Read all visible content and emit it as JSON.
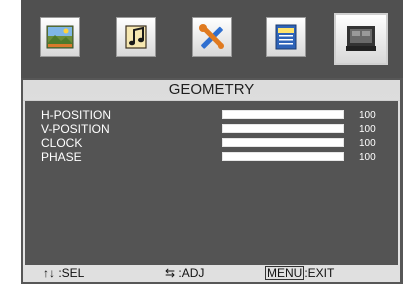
{
  "menu": {
    "tabs": [
      {
        "icon": "picture-icon",
        "selected": false
      },
      {
        "icon": "audio-icon",
        "selected": false
      },
      {
        "icon": "setup-tools-icon",
        "selected": false
      },
      {
        "icon": "info-icon",
        "selected": false
      },
      {
        "icon": "geometry-monitor-icon",
        "selected": true
      }
    ],
    "title": "GEOMETRY",
    "items": [
      {
        "label": "H-POSITION",
        "value": "100",
        "level": 1.0
      },
      {
        "label": "V-POSITION",
        "value": "100",
        "level": 1.0
      },
      {
        "label": "CLOCK",
        "value": "100",
        "level": 1.0
      },
      {
        "label": "PHASE",
        "value": "100",
        "level": 1.0
      }
    ]
  },
  "footer": {
    "sel_symbol": "↑↓",
    "sel_label": ":SEL",
    "adj_symbol": "⇆",
    "adj_label": ":ADJ",
    "menu_key": "MENU",
    "exit_label": ":EXIT"
  }
}
